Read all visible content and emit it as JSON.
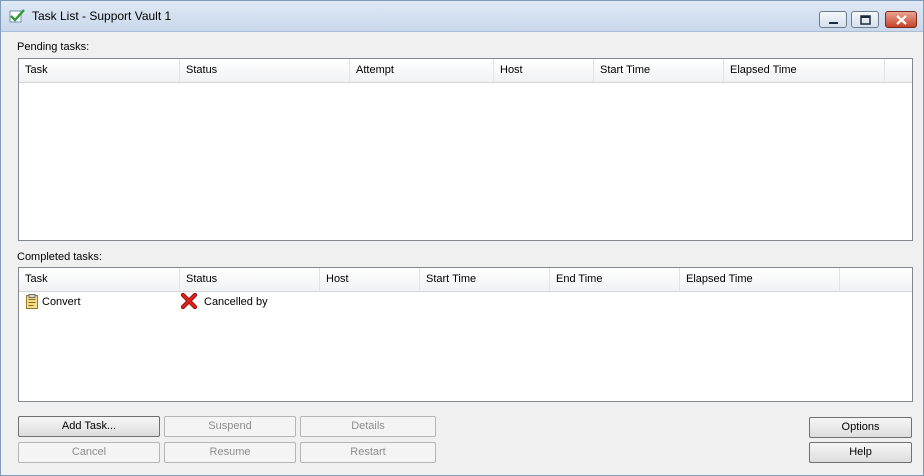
{
  "window": {
    "title": "Task List - Support Vault 1"
  },
  "pending": {
    "label": "Pending tasks:",
    "columns": [
      "Task",
      "Status",
      "Attempt",
      "Host",
      "Start Time",
      "Elapsed Time"
    ]
  },
  "completed": {
    "label": "Completed tasks:",
    "columns": [
      "Task",
      "Status",
      "Host",
      "Start Time",
      "End Time",
      "Elapsed Time"
    ],
    "rows": [
      {
        "task": "Convert",
        "status": "Cancelled by",
        "status_icon": "red-x-icon",
        "task_icon": "clipboard-task-icon"
      }
    ]
  },
  "buttons": {
    "add_task": "Add Task...",
    "suspend": "Suspend",
    "details": "Details",
    "cancel": "Cancel",
    "resume": "Resume",
    "restart": "Restart",
    "options": "Options",
    "help": "Help"
  },
  "colors": {
    "title_gradient_top": "#dfe9f5",
    "close_button": "#c7422a",
    "disabled_text": "#8d8d8d"
  }
}
